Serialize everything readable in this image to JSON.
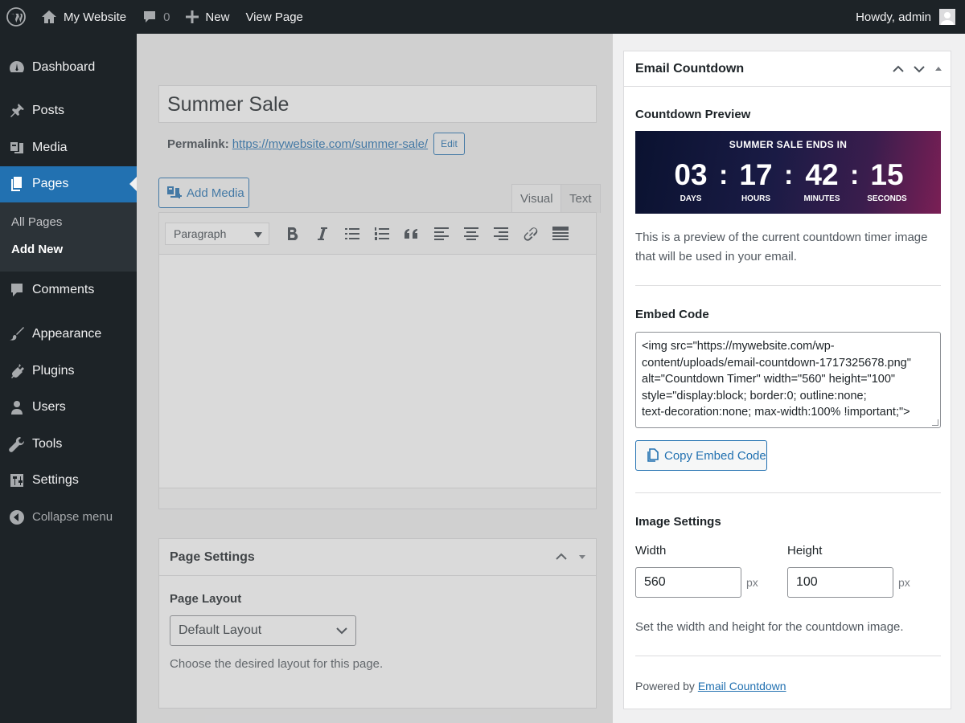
{
  "adminbar": {
    "site_name": "My Website",
    "comments_count": "0",
    "new_label": "New",
    "view_page_label": "View Page",
    "howdy": "Howdy, admin"
  },
  "sidebar": {
    "items": [
      {
        "label": "Dashboard",
        "icon": "dashboard-icon"
      },
      {
        "label": "Posts",
        "icon": "pin-icon"
      },
      {
        "label": "Media",
        "icon": "media-icon"
      },
      {
        "label": "Pages",
        "icon": "pages-icon",
        "active": true
      },
      {
        "label": "Comments",
        "icon": "comment-icon"
      },
      {
        "label": "Appearance",
        "icon": "brush-icon"
      },
      {
        "label": "Plugins",
        "icon": "plug-icon"
      },
      {
        "label": "Users",
        "icon": "user-icon"
      },
      {
        "label": "Tools",
        "icon": "wrench-icon"
      },
      {
        "label": "Settings",
        "icon": "settings-icon"
      }
    ],
    "submenu": [
      "All Pages",
      "Add New"
    ],
    "collapse_label": "Collapse menu"
  },
  "editor": {
    "title": "Summer Sale",
    "permalink_label": "Permalink:",
    "permalink_url": "https://mywebsite.com/summer-sale/",
    "edit_label": "Edit",
    "add_media_label": "Add Media",
    "tab_visual": "Visual",
    "tab_text": "Text",
    "format_value": "Paragraph"
  },
  "page_settings": {
    "title": "Page Settings",
    "layout_label": "Page Layout",
    "layout_value": "Default Layout",
    "layout_desc": "Choose the desired layout for this page."
  },
  "email_countdown": {
    "title": "Email Countdown",
    "preview_title": "Countdown Preview",
    "banner_title": "SUMMER SALE ENDS IN",
    "units": [
      {
        "value": "03",
        "label": "DAYS"
      },
      {
        "value": "17",
        "label": "HOURS"
      },
      {
        "value": "42",
        "label": "MINUTES"
      },
      {
        "value": "15",
        "label": "SECONDS"
      }
    ],
    "separator": ":",
    "preview_desc_1": "This is a preview of the current countdown timer image",
    "preview_desc_2": "that will be used in your email.",
    "embed_title": "Embed Code",
    "embed_lines": [
      "<img src=\"https://mywebsite.com/wp-",
      "content/uploads/email-countdown-1717325678.png\"",
      "alt=\"Countdown Timer\" width=\"560\" height=\"100\"",
      "style=\"display:block; border:0; outline:none;",
      "text-decoration:none; max-width:100% !important;\">"
    ],
    "copy_label": "Copy Embed Code",
    "image_settings_title": "Image Settings",
    "width_label": "Width",
    "width_value": "560",
    "height_label": "Height",
    "height_value": "100",
    "unit": "px",
    "image_desc": "Set the width and height for the countdown image.",
    "powered_by": "Powered by",
    "powered_link": "Email Countdown"
  },
  "colors": {
    "accent": "#2271b1",
    "adminbar_bg": "#1d2327",
    "banner_start": "#0a1230",
    "banner_end": "#7a1f55"
  }
}
